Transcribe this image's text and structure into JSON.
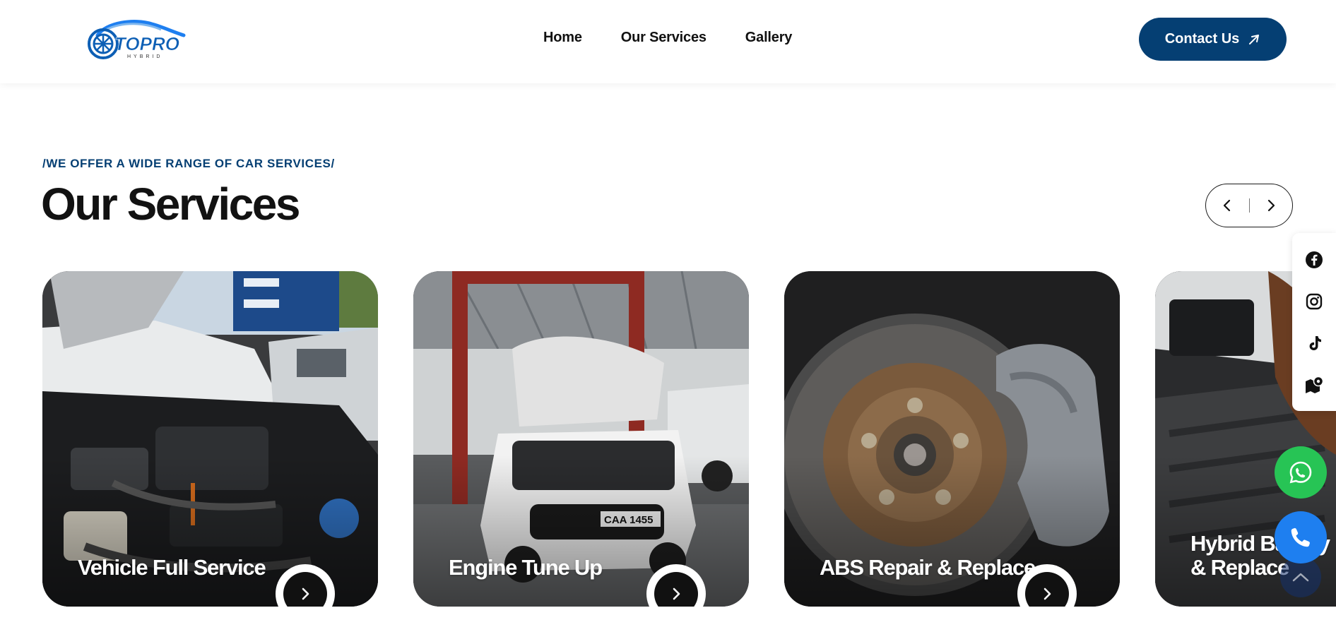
{
  "header": {
    "logo_text": "TOPRO",
    "logo_subtext": "HYBRID",
    "nav": [
      {
        "label": "Home"
      },
      {
        "label": "Our Services"
      },
      {
        "label": "Gallery"
      }
    ],
    "contact_label": "Contact Us"
  },
  "section": {
    "eyebrow": "/WE OFFER A WIDE RANGE OF CAR SERVICES/",
    "title": "Our Services",
    "prev_icon": "chevron-left-icon",
    "next_icon": "chevron-right-icon"
  },
  "services": [
    {
      "title": "Vehicle Full Service"
    },
    {
      "title": "Engine Tune Up"
    },
    {
      "title": "ABS Repair & Replace"
    },
    {
      "title_line1": "Hybrid Battery",
      "title_line2": "& Replace"
    }
  ],
  "social": [
    {
      "icon": "facebook-icon"
    },
    {
      "icon": "instagram-icon"
    },
    {
      "icon": "tiktok-icon"
    },
    {
      "icon": "map-icon"
    }
  ],
  "floating": {
    "whatsapp_icon": "whatsapp-icon",
    "call_icon": "phone-icon",
    "scroll_top_icon": "chevron-up-icon"
  },
  "colors": {
    "brand": "#053f73",
    "whatsapp": "#27c455",
    "call": "#1e7ff0",
    "text": "#121212"
  }
}
